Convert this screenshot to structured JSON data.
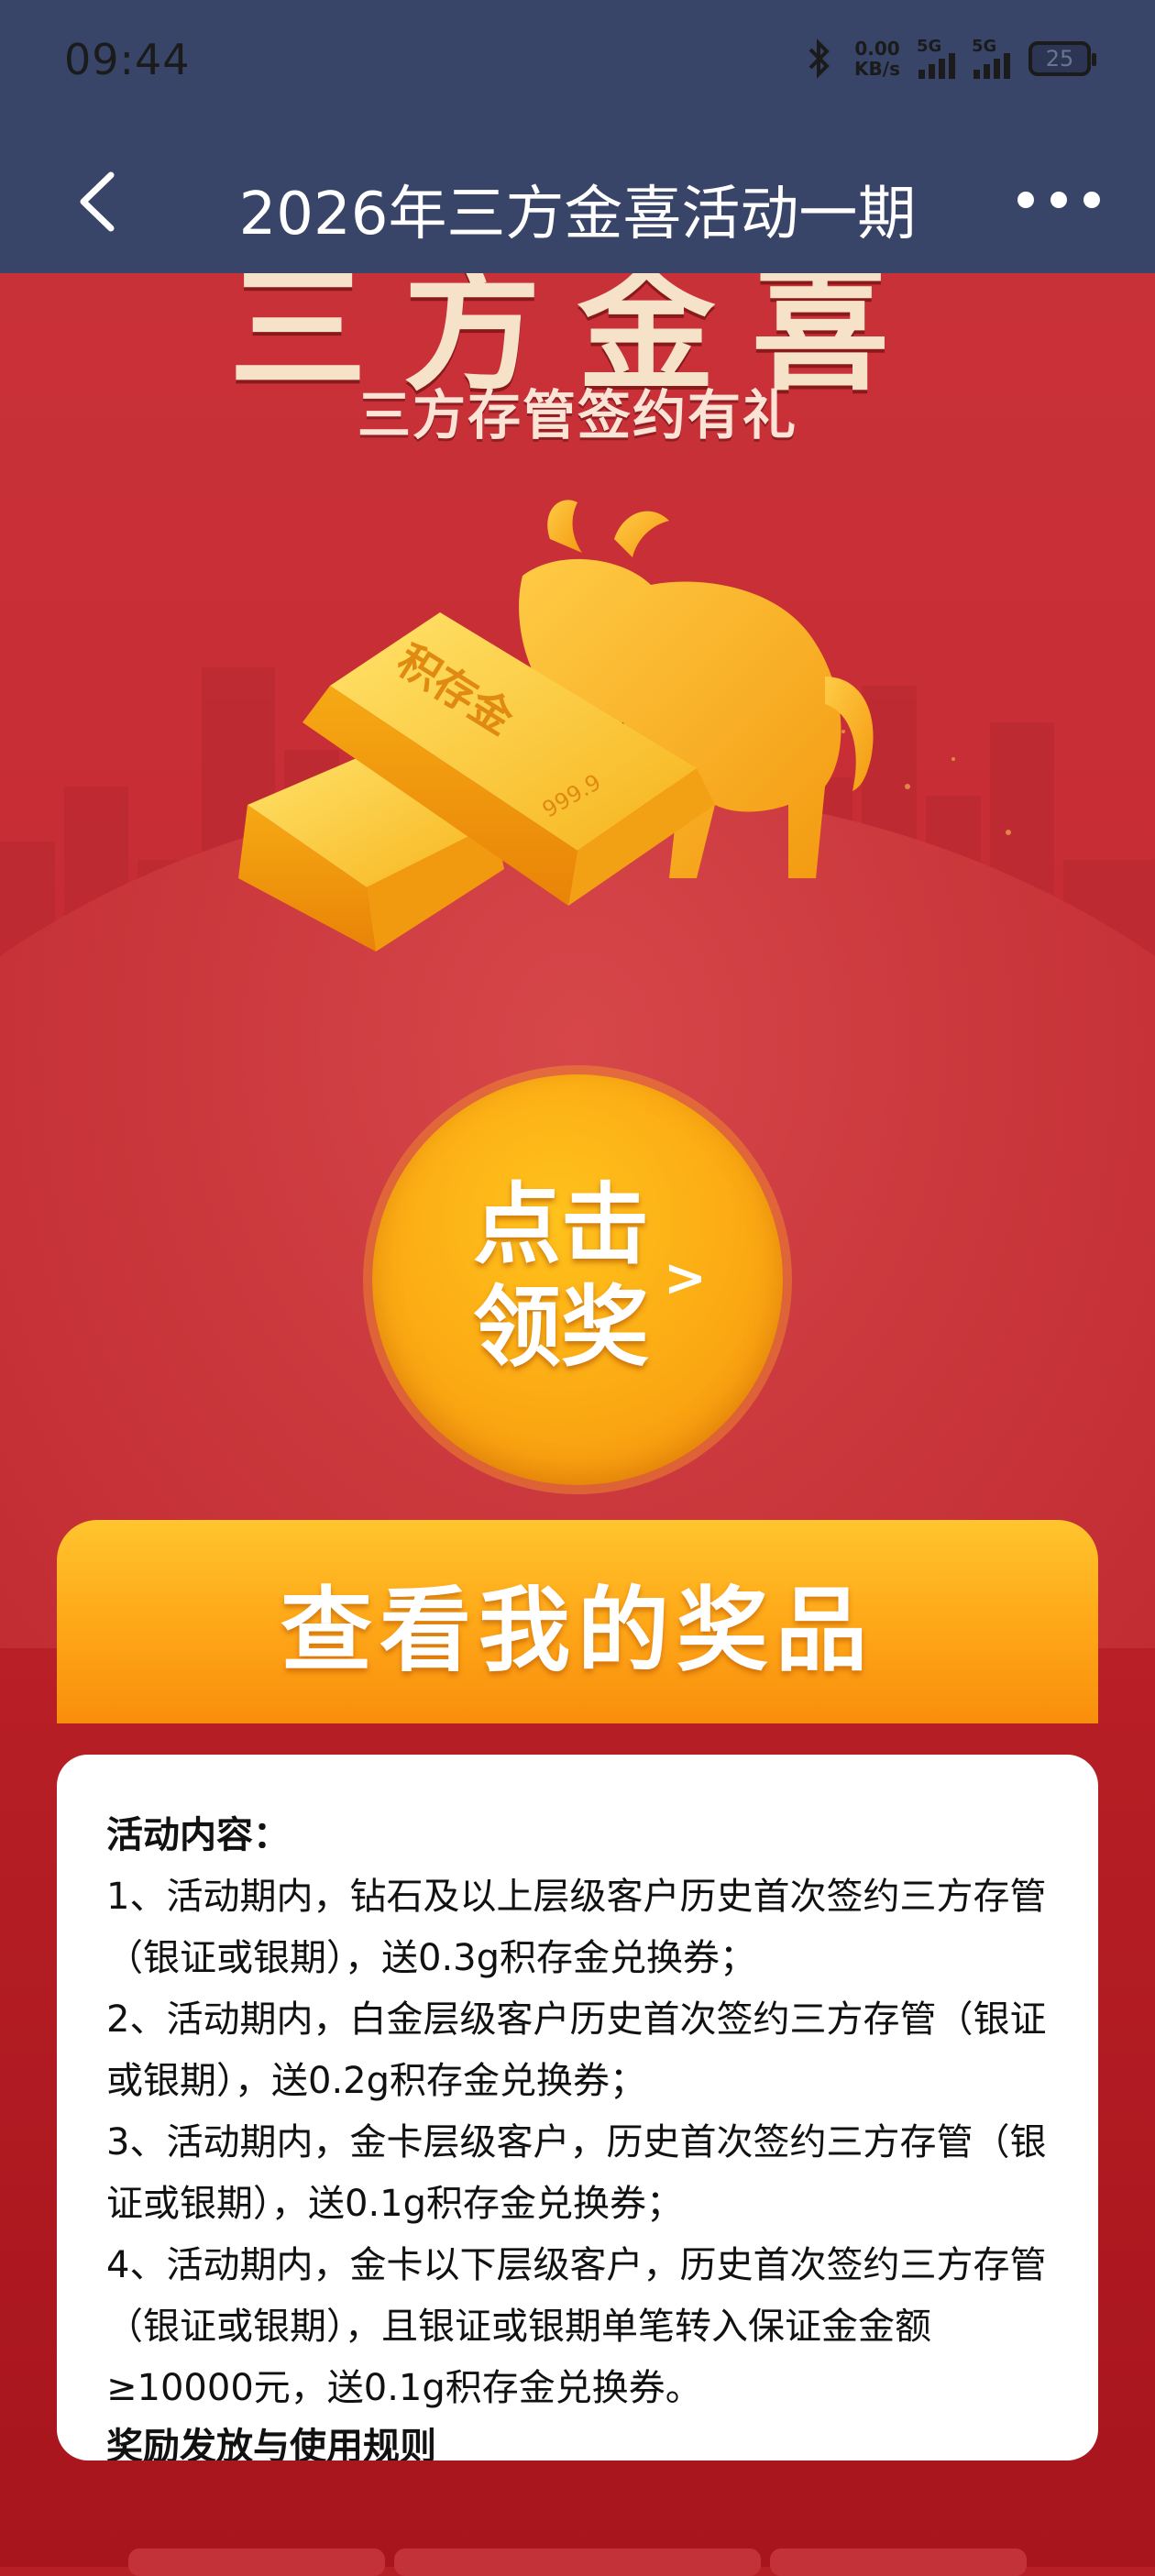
{
  "status_bar": {
    "time": "09:44",
    "net_speed_value": "0.00",
    "net_speed_unit": "KB/s",
    "signal1_label": "5G",
    "signal2_label": "5G",
    "battery": "25"
  },
  "nav": {
    "title": "2026年三方金喜活动一期"
  },
  "hero": {
    "title": "三方金喜",
    "subtitle": "三方存管签约有礼",
    "bar_top_text": "积存金",
    "bar_stamp": "999.9"
  },
  "claim": {
    "label_line1": "点击",
    "label_line2": "领奖",
    "arrow": ">"
  },
  "prize_button": {
    "label": "查看我的奖品"
  },
  "info": {
    "heading": "活动内容：",
    "items": [
      "1、活动期内，钻石及以上层级客户历史首次签约三方存管（银证或银期），送0.3g积存金兑换券；",
      "2、活动期内，白金层级客户历史首次签约三方存管（银证或银期），送0.2g积存金兑换券；",
      "3、活动期内，金卡层级客户，历史首次签约三方存管（银证或银期），送0.1g积存金兑换券；",
      "4、活动期内，金卡以下层级客户，历史首次签约三方存管（银证或银期），且银证或银期单笔转入保证金金额≥10000元，送0.1g积存金兑换券。"
    ],
    "rules_heading": "奖励发放与使用规则"
  },
  "colors": {
    "nav_bg": "#384569",
    "page_red": "#c72c34",
    "gold": "#fba913",
    "card": "#ffffff"
  }
}
